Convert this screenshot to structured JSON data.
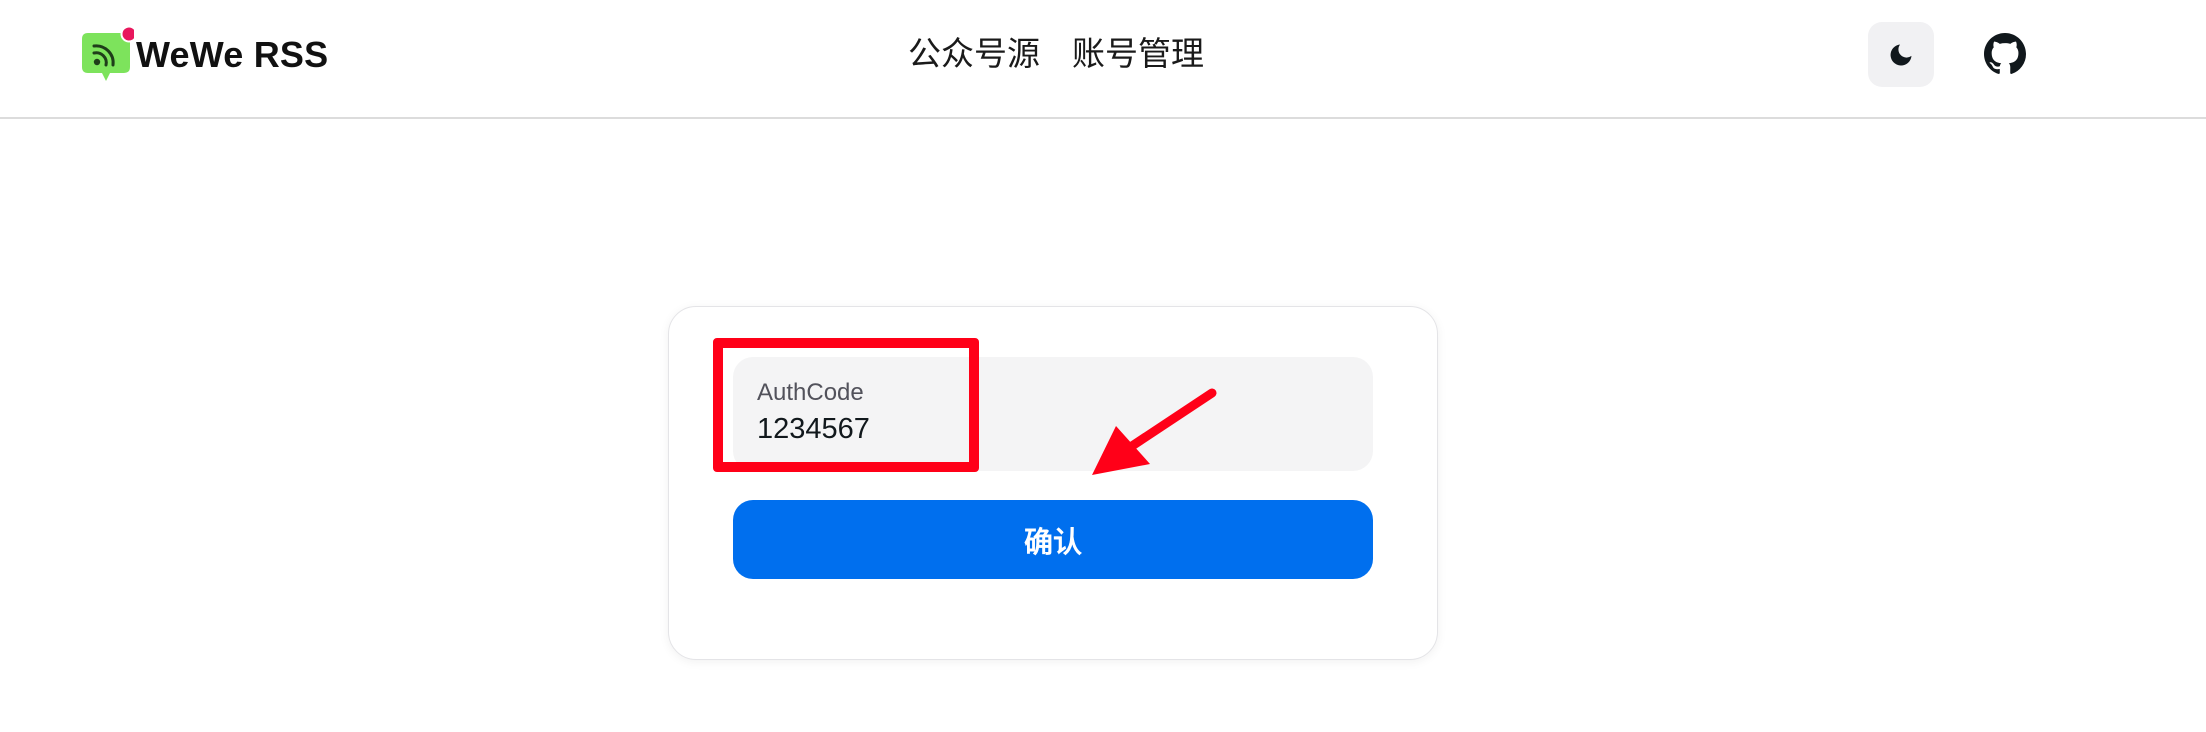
{
  "header": {
    "brand_name": "WeWe RSS",
    "nav": [
      {
        "label": "公众号源"
      },
      {
        "label": "账号管理"
      }
    ],
    "icons": {
      "logo": "rss-chat-logo-icon",
      "theme_toggle": "moon-icon",
      "github": "github-icon"
    }
  },
  "auth_form": {
    "field_label": "AuthCode",
    "field_value": "1234567",
    "confirm_label": "确认"
  },
  "colors": {
    "primary": "#006fee",
    "logo_green": "#7de35c",
    "notification_dot": "#e8175d",
    "annotation_red": "#ff0018"
  }
}
